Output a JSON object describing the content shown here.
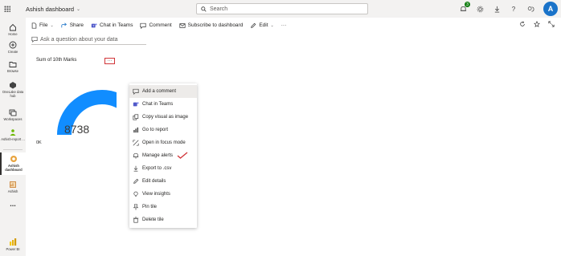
{
  "topbar": {
    "app_title": "Ashish dashboard",
    "search_placeholder": "Search",
    "notification_count": "3",
    "avatar_initial": "A"
  },
  "nav": {
    "items": [
      {
        "label": "Home"
      },
      {
        "label": "Create"
      },
      {
        "label": "Browse"
      },
      {
        "label": "OneLake data hub"
      },
      {
        "label": "Workspaces"
      },
      {
        "label": "Ashish-report ..."
      },
      {
        "label": "Ashish dashboard"
      },
      {
        "label": "Ashish"
      },
      {
        "label": "..."
      },
      {
        "label": "Power BI"
      }
    ]
  },
  "toolbar": {
    "file": "File",
    "share": "Share",
    "chat": "Chat in Teams",
    "comment": "Comment",
    "subscribe": "Subscribe to dashboard",
    "edit": "Edit",
    "more": "···"
  },
  "qa": {
    "placeholder": "Ask a question about your data"
  },
  "tile": {
    "title": "Sum of 10th Marks",
    "more": "···",
    "value": "8738",
    "min_label": "0K",
    "gauge_fill_fraction": 0.85,
    "gauge_color": "#118dff",
    "gauge_track": "#e6e6e6"
  },
  "context_menu": {
    "items": [
      {
        "label": "Add a comment",
        "icon": "comment-icon"
      },
      {
        "label": "Chat in Teams",
        "icon": "teams-icon"
      },
      {
        "label": "Copy visual as image",
        "icon": "copy-icon"
      },
      {
        "label": "Go to report",
        "icon": "report-icon"
      },
      {
        "label": "Open in focus mode",
        "icon": "focus-icon"
      },
      {
        "label": "Manage alerts",
        "icon": "bell-icon"
      },
      {
        "label": "Export to .csv",
        "icon": "export-icon"
      },
      {
        "label": "Edit details",
        "icon": "pencil-icon"
      },
      {
        "label": "View insights",
        "icon": "lightbulb-icon"
      },
      {
        "label": "Pin tile",
        "icon": "pin-icon"
      },
      {
        "label": "Delete tile",
        "icon": "trash-icon"
      }
    ]
  },
  "colors": {
    "accent": "#1a73c9",
    "annotation": "#d13438"
  }
}
